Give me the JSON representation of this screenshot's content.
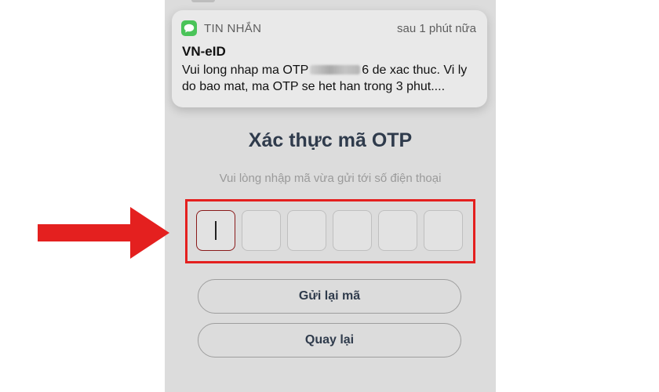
{
  "notification": {
    "app_icon": "messages-icon",
    "app_name": "TIN NHẮN",
    "time": "sau 1 phút nữa",
    "sender": "VN-eID",
    "body_before_code": "Vui long nhap ma OTP",
    "body_after_code": "6 de xac thuc. Vi ly do bao mat, ma OTP se het han trong 3 phut...."
  },
  "otp": {
    "title": "Xác thực mã OTP",
    "subtitle": "Vui lòng nhập mã vừa gửi tới số điện thoại",
    "cells": [
      "",
      "",
      "",
      "",
      "",
      ""
    ],
    "active_index": 0
  },
  "buttons": {
    "resend": "Gửi lại mã",
    "back": "Quay lại"
  },
  "annotation": {
    "arrow_color": "#e4201f",
    "box_color": "#e4201f"
  }
}
